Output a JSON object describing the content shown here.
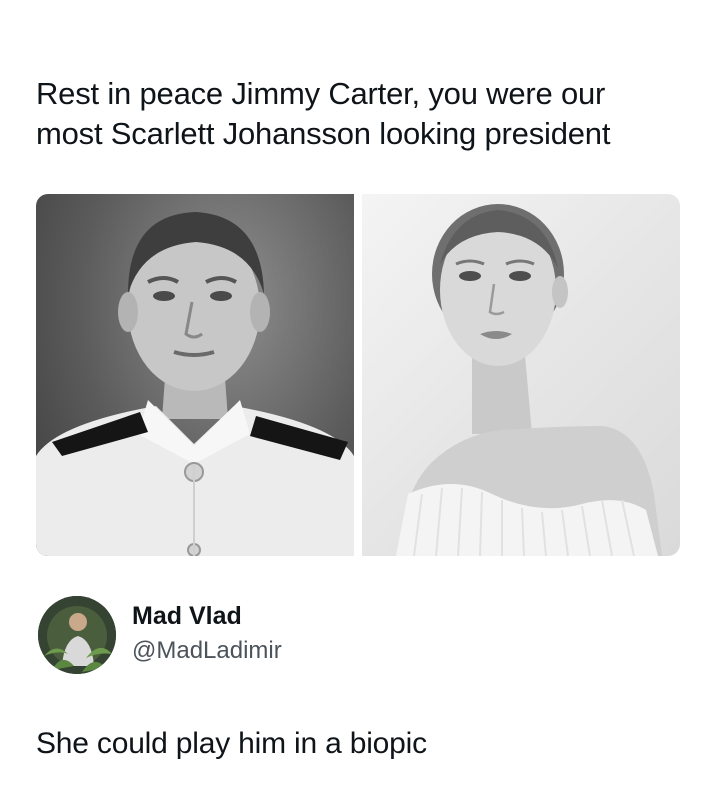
{
  "post": {
    "text_line1": "Rest in peace Jimmy Carter, you were our",
    "text_line2": "most Scarlett Johansson looking president"
  },
  "images": [
    {
      "name": "jimmy-carter-photo",
      "icon": "portrait-man-uniform"
    },
    {
      "name": "scarlett-johansson-photo",
      "icon": "portrait-woman"
    }
  ],
  "reply": {
    "author_name": "Mad Vlad",
    "author_handle": "@MadLadimir",
    "text": "She could play him in a biopic"
  }
}
